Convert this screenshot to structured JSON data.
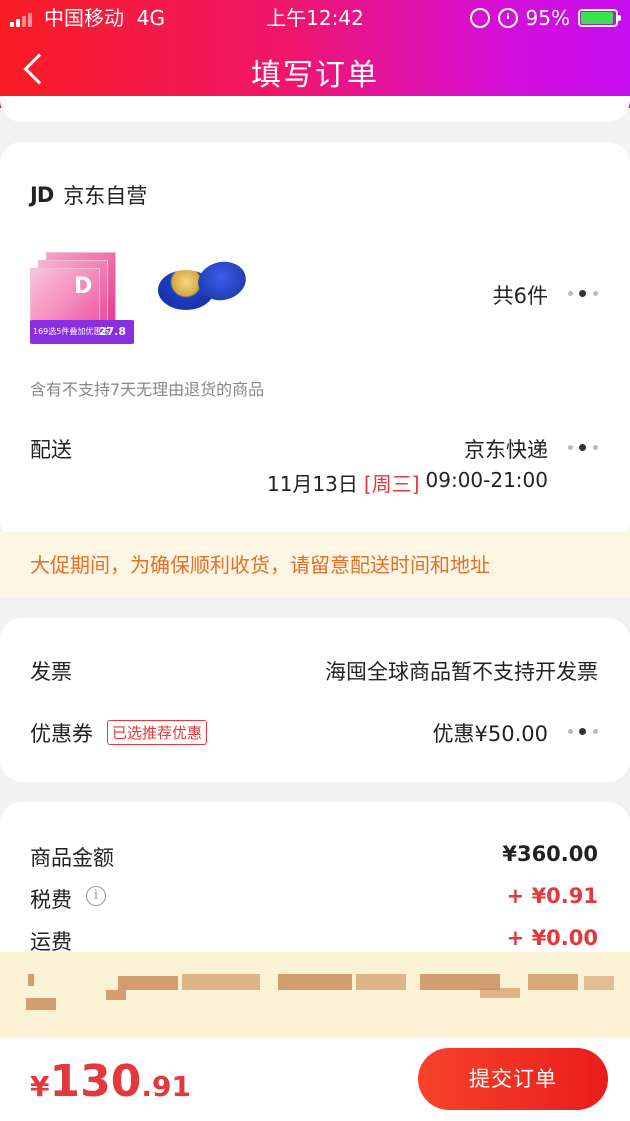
{
  "status_bar": {
    "carrier": "中国移动",
    "network": "4G",
    "time": "上午12:42",
    "battery": "95%"
  },
  "nav": {
    "title": "填写订单"
  },
  "store": {
    "name": "京东自营",
    "logo_text": "JD",
    "item_count": "共6件",
    "promo_badge": "169选5件叠加优惠券",
    "promo_price": "27.8",
    "return_notice": "含有不支持7天无理由退货的商品"
  },
  "delivery": {
    "label": "配送",
    "carrier": "京东快递",
    "date": "11月13日",
    "weekday": "[周三]",
    "time_range": "09:00-21:00"
  },
  "promo_notice": "大促期间，为确保顺利收货，请留意配送时间和地址",
  "invoice": {
    "label": "发票",
    "value": "海囤全球商品暂不支持开发票"
  },
  "coupon": {
    "label": "优惠券",
    "tag": "已选推荐优惠",
    "value": "优惠¥50.00"
  },
  "summary": {
    "goods_label": "商品金额",
    "goods_value": "¥360.00",
    "tax_label": "税费",
    "tax_value": "+ ¥0.91",
    "shipping_label": "运费",
    "shipping_value": "+ ¥0.00"
  },
  "footer": {
    "currency": "¥",
    "total_int": "130",
    "total_dec": ".91",
    "submit_label": "提交订单"
  },
  "colors": {
    "accent_red": "#e4393c",
    "notice_orange": "#e4702c"
  }
}
